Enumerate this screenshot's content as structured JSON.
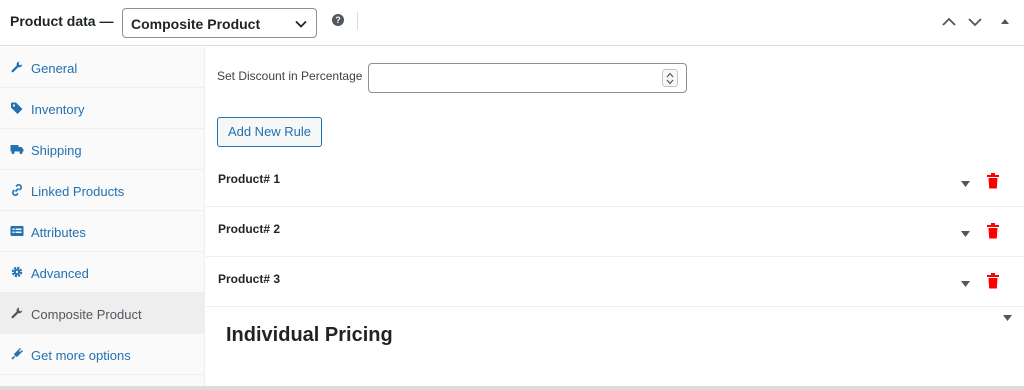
{
  "header": {
    "title": "Product data —",
    "product_type": "Composite Product",
    "help": "?"
  },
  "sidebar": {
    "items": [
      {
        "label": "General",
        "icon": "wrench-icon"
      },
      {
        "label": "Inventory",
        "icon": "tag-icon"
      },
      {
        "label": "Shipping",
        "icon": "truck-icon"
      },
      {
        "label": "Linked Products",
        "icon": "link-icon"
      },
      {
        "label": "Attributes",
        "icon": "list-icon"
      },
      {
        "label": "Advanced",
        "icon": "gear-icon"
      },
      {
        "label": "Composite Product",
        "icon": "wrench-icon",
        "active": true
      },
      {
        "label": "Get more options",
        "icon": "plugin-icon"
      }
    ]
  },
  "main": {
    "discount_label": "Set Discount in Percentage",
    "discount_value": "",
    "add_rule_label": "Add New Rule",
    "rules": [
      {
        "label": "Product# 1"
      },
      {
        "label": "Product# 2"
      },
      {
        "label": "Product# 3"
      }
    ],
    "pricing_title": "Individual Pricing"
  },
  "colors": {
    "link": "#2271b1",
    "delete": "#ff0000",
    "text": "#1d2327"
  }
}
